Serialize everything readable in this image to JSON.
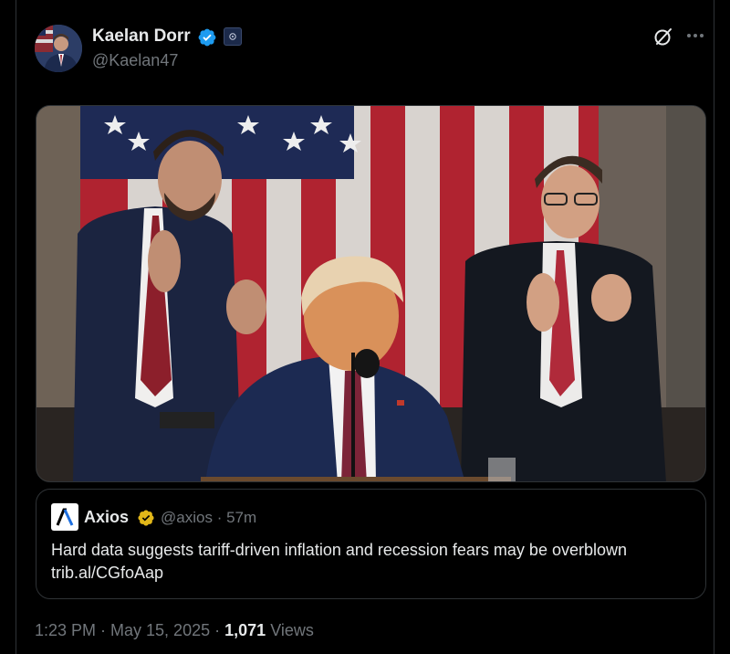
{
  "post": {
    "author_name": "Kaelan Dorr",
    "author_handle": "@Kaelan47",
    "timestamp": "1:23 PM · May 15, 2025 ·",
    "views_count": "1,071",
    "views_label": "Views"
  },
  "quote": {
    "author_name": "Axios",
    "author_handle": "@axios",
    "age": "· 57m",
    "text": "Hard data suggests tariff-driven inflation and recession fears may be overblown trib.al/CGfoAap"
  },
  "colors": {
    "background": "#000000",
    "text_primary": "#e7e9ea",
    "text_secondary": "#71767b",
    "verified_blue": "#1d9bf0",
    "verified_gold": "#e2b719",
    "border": "#2f3336"
  },
  "icons": {
    "verified": "verified-badge-icon",
    "affiliation": "affiliation-badge-icon",
    "grok": "grok-icon",
    "more": "more-options-icon",
    "quote_verified": "gold-verified-badge-icon"
  }
}
